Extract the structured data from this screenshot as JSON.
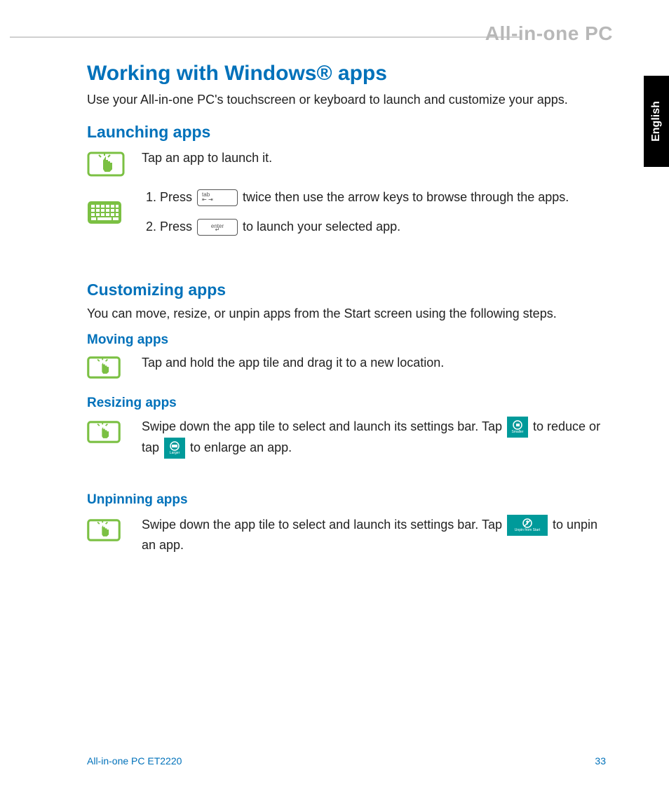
{
  "header": {
    "brand": "All-in-one PC"
  },
  "lang": "English",
  "h1": "Working with Windows® apps",
  "intro": "Use your All-in-one PC's touchscreen or keyboard to launch and customize your apps.",
  "launching": {
    "title": "Launching apps",
    "tap": "Tap an app to launch it.",
    "step1_a": "Press ",
    "step1_b": " twice then use the arrow keys to browse through the apps.",
    "step2_a": "Press ",
    "step2_b": " to launch your selected app."
  },
  "customizing": {
    "title": "Customizing apps",
    "intro": "You can move, resize, or unpin apps from the Start screen using the following steps."
  },
  "moving": {
    "title": "Moving apps",
    "text": "Tap and hold the app tile and drag it to a new location."
  },
  "resizing": {
    "title": "Resizing apps",
    "text_a": "Swipe down the app tile to select and launch its settings bar. Tap ",
    "text_b": " to reduce or tap ",
    "text_c": " to enlarge an app.",
    "icon1_label": "Smaller",
    "icon2_label": "Larger"
  },
  "unpinning": {
    "title": "Unpinning apps",
    "text_a": "Swipe down the app tile to select and launch its settings bar. Tap ",
    "text_b": " to unpin an app.",
    "icon_label": "Unpin from Start"
  },
  "keys": {
    "tab": "tab",
    "enter": "enter"
  },
  "footer": {
    "model": "All-in-one PC ET2220",
    "page": "33"
  }
}
